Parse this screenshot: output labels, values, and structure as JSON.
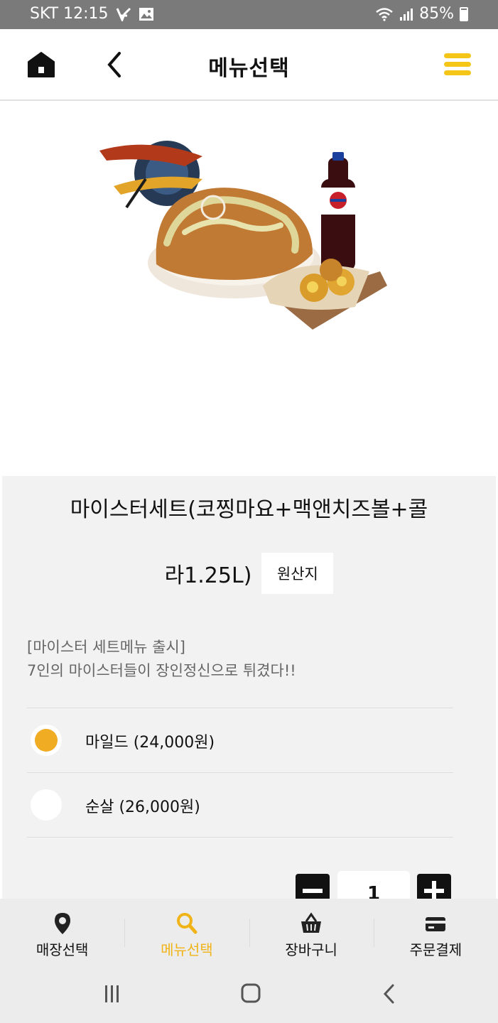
{
  "status_bar": {
    "carrier_time": "SKT 12:15",
    "battery": "85%"
  },
  "header": {
    "title": "메뉴선택",
    "icons": {
      "home": "home-icon",
      "back": "back-arrow-icon",
      "menu": "hamburger-menu-icon"
    },
    "accent_color": "#f5c518"
  },
  "product": {
    "image": "chicken-set-with-cola-photo",
    "name_line1": "마이스터세트(코찡마요+맥앤치즈볼+콜",
    "name_line2": "라1.25L)",
    "origin_button": "원산지",
    "description_line1": "[마이스터 세트메뉴 출시]",
    "description_line2": "7인의 마이스터들이 장인정신으로 튀겼다!!",
    "options": [
      {
        "label": "마일드 (24,000원)",
        "selected": true
      },
      {
        "label": "순살 (26,000원)",
        "selected": false
      }
    ],
    "quantity": "1",
    "selected_color": "#f0ac23"
  },
  "bottom_nav": {
    "items": [
      {
        "label": "매장선택",
        "icon": "map-pin-icon",
        "active": false
      },
      {
        "label": "메뉴선택",
        "icon": "search-icon",
        "active": true
      },
      {
        "label": "장바구니",
        "icon": "basket-icon",
        "active": false
      },
      {
        "label": "주문결제",
        "icon": "credit-card-icon",
        "active": false
      }
    ],
    "active_color": "#f0b418"
  },
  "system_nav": {
    "icons": [
      "recent-apps-icon",
      "home-circle-icon",
      "system-back-icon"
    ]
  }
}
